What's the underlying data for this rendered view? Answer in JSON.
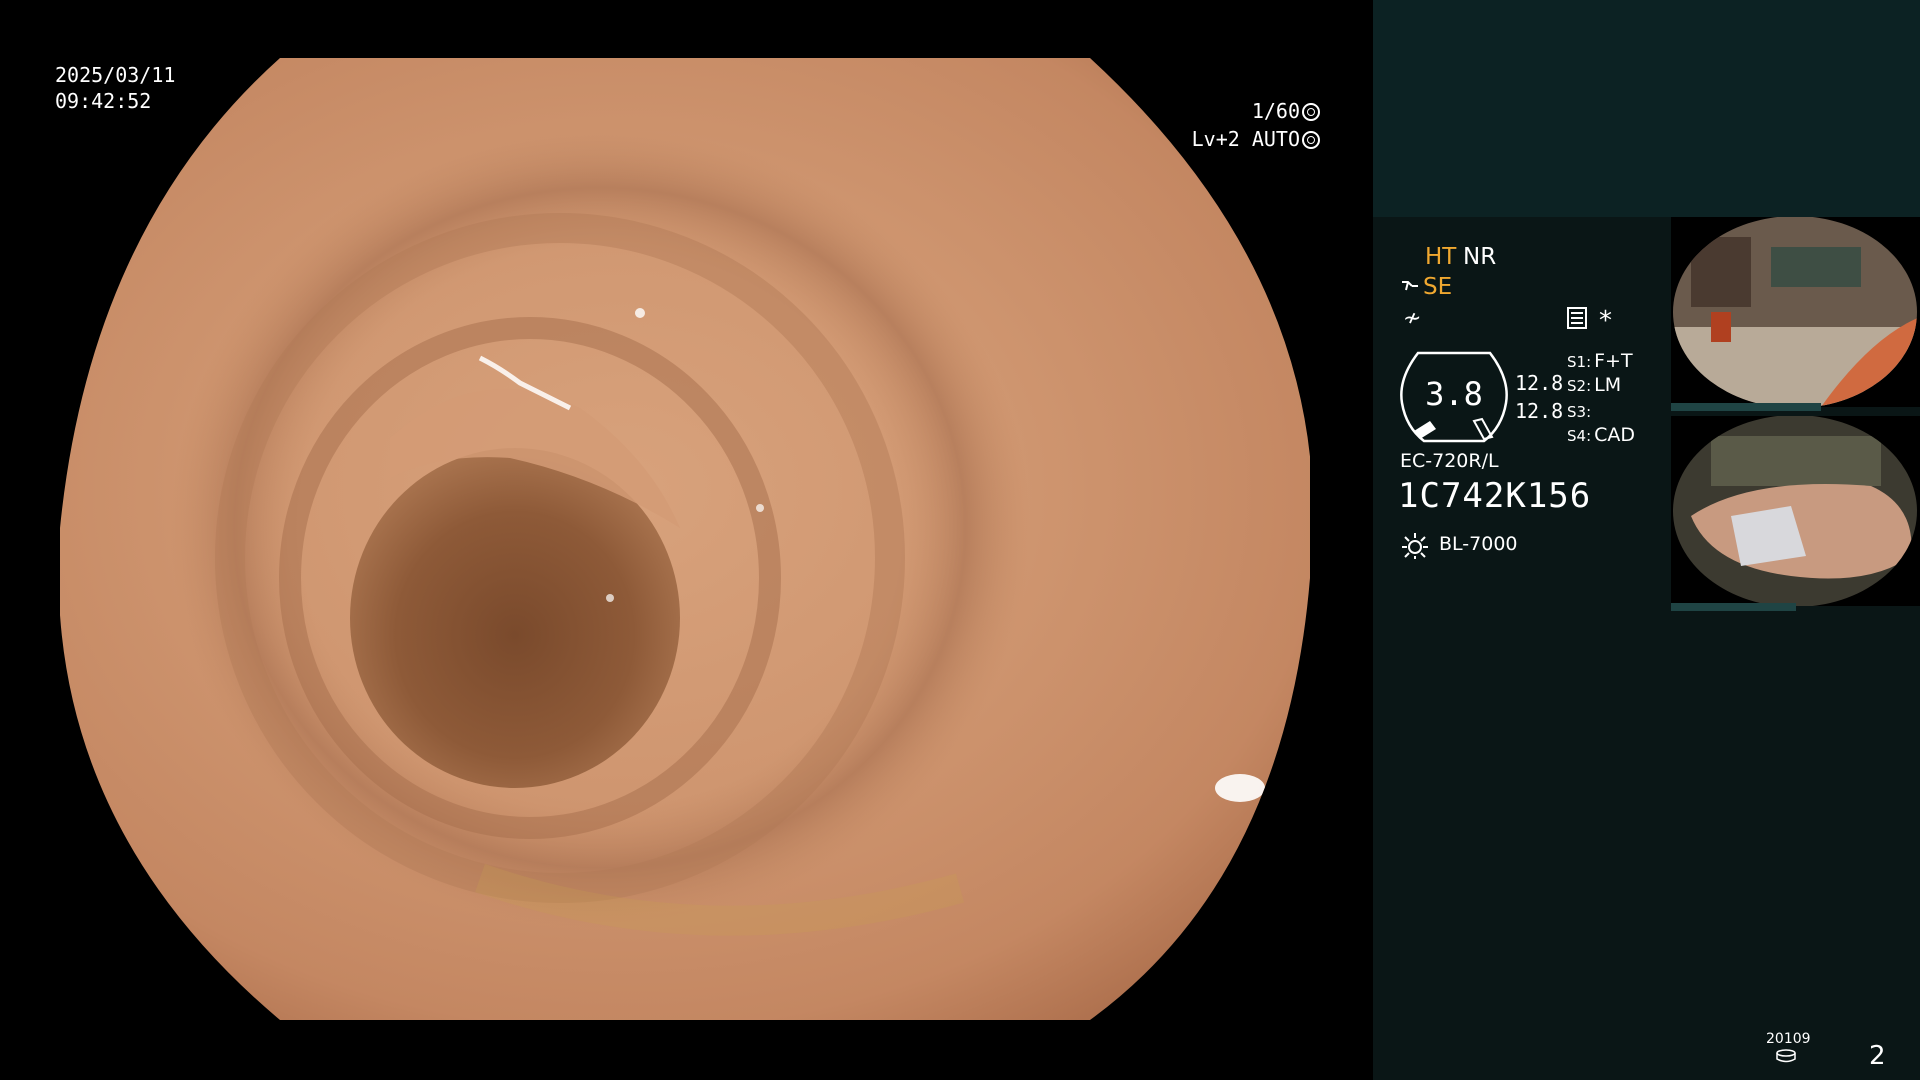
{
  "overlay": {
    "date": "2025/03/11",
    "time": "09:42:52",
    "shutter": "1/60",
    "level_auto": "Lv+2 AUTO"
  },
  "panel": {
    "ht": "HT",
    "nr": "NR",
    "se": "SE",
    "structure_symbol": "≁",
    "asterisk": "*",
    "gauge_value": "3.8",
    "gauge_side_1": "12.8",
    "gauge_side_2": "12.8",
    "slots": [
      {
        "key": "S1:",
        "value": "F+T"
      },
      {
        "key": "S2:",
        "value": "LM"
      },
      {
        "key": "S3:",
        "value": ""
      },
      {
        "key": "S4:",
        "value": "CAD"
      }
    ],
    "scope_model": "EC-720R/L",
    "scope_serial": "1C742K156",
    "light_source": "BL-7000",
    "file_number": "20109",
    "page_number": "2"
  },
  "icons": [
    "shutter-icon",
    "auto-iris-icon",
    "se-icon",
    "menu-icon",
    "sun-icon",
    "disk-icon"
  ],
  "colors": {
    "highlight": "#f0a830",
    "panel_bg": "#0a1616",
    "panel_top": "#0c2223"
  }
}
